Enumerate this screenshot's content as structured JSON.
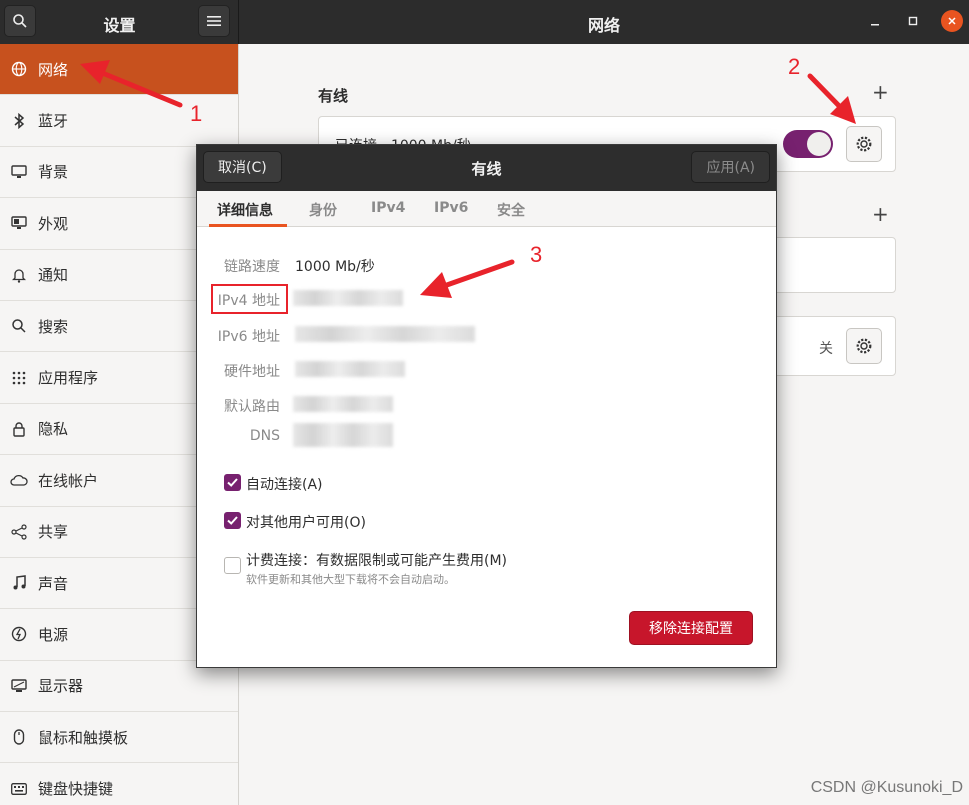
{
  "header": {
    "sidebar_title": "设置",
    "main_title": "网络"
  },
  "sidebar": {
    "items": [
      {
        "label": "网络",
        "icon": "globe-icon"
      },
      {
        "label": "蓝牙",
        "icon": "bluetooth-icon"
      },
      {
        "label": "背景",
        "icon": "monitor-icon"
      },
      {
        "label": "外观",
        "icon": "appearance-icon"
      },
      {
        "label": "通知",
        "icon": "bell-icon"
      },
      {
        "label": "搜索",
        "icon": "search-icon"
      },
      {
        "label": "应用程序",
        "icon": "grid-icon"
      },
      {
        "label": "隐私",
        "icon": "lock-icon"
      },
      {
        "label": "在线帐户",
        "icon": "cloud-icon"
      },
      {
        "label": "共享",
        "icon": "share-icon"
      },
      {
        "label": "声音",
        "icon": "music-note-icon"
      },
      {
        "label": "电源",
        "icon": "power-icon"
      },
      {
        "label": "显示器",
        "icon": "display-icon"
      },
      {
        "label": "鼠标和触摸板",
        "icon": "mouse-icon"
      },
      {
        "label": "键盘快捷键",
        "icon": "keyboard-icon"
      }
    ]
  },
  "main": {
    "wired_section_title": "有线",
    "wired_status": "已连接 - 1000 Mb/秒",
    "proxy_state": "关"
  },
  "dialog": {
    "title": "有线",
    "cancel_label": "取消(C)",
    "apply_label": "应用(A)",
    "tabs": [
      "详细信息",
      "身份",
      "IPv4",
      "IPv6",
      "安全"
    ],
    "rows": [
      {
        "label": "链路速度",
        "value": "1000 Mb/秒"
      },
      {
        "label": "IPv4 地址",
        "value": ""
      },
      {
        "label": "IPv6 地址",
        "value": ""
      },
      {
        "label": "硬件地址",
        "value": ""
      },
      {
        "label": "默认路由",
        "value": ""
      },
      {
        "label": "DNS",
        "value": ""
      }
    ],
    "auto_connect_label": "自动连接(A)",
    "auto_connect_checked": true,
    "all_users_label": "对其他用户可用(O)",
    "all_users_checked": true,
    "metered_label": "计费连接：有数据限制或可能产生费用(M)",
    "metered_sub": "软件更新和其他大型下载将不会自动启动。",
    "metered_checked": false,
    "remove_label": "移除连接配置"
  },
  "annotations": {
    "num1": "1",
    "num2": "2",
    "num3": "3",
    "color": "#e8232b"
  },
  "watermark": "CSDN @Kusunoki_D",
  "colors": {
    "accent": "#e95420",
    "sidebar_active": "#c7511e",
    "toggle": "#77216f",
    "danger": "#c7162b"
  }
}
